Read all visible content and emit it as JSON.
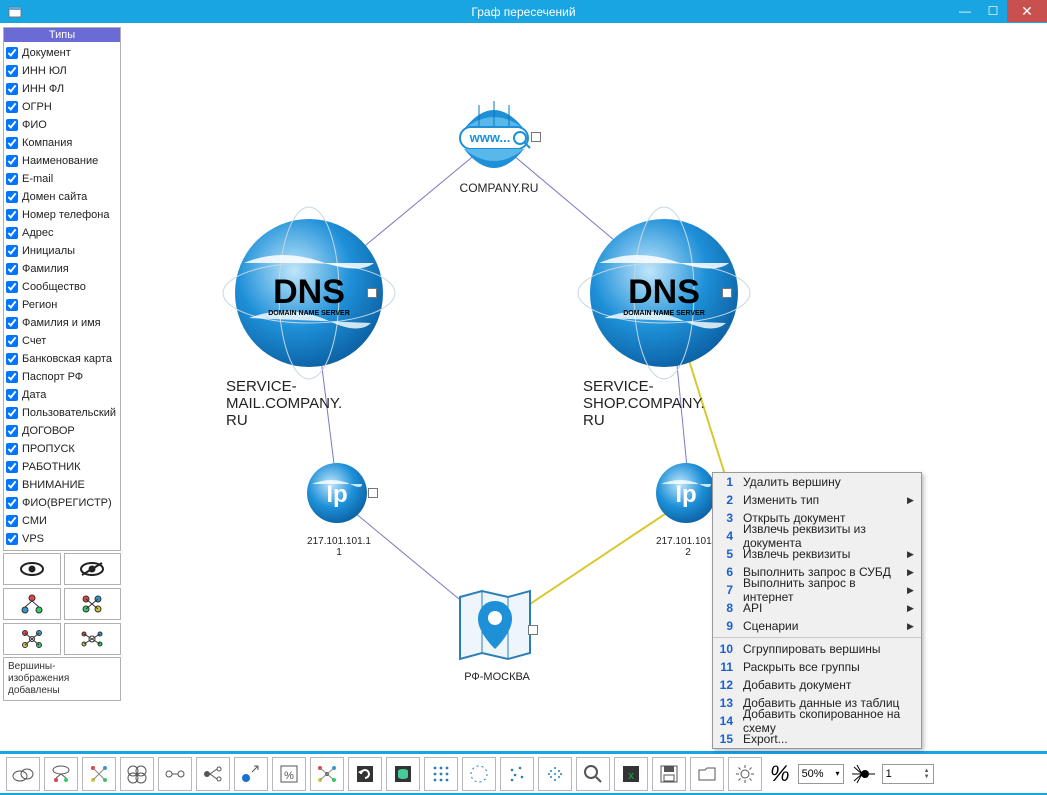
{
  "window": {
    "title": "Граф пересечений"
  },
  "sidebar": {
    "types_title": "Типы",
    "types": [
      "Документ",
      "ИНН ЮЛ",
      "ИНН ФЛ",
      "ОГРН",
      "ФИО",
      "Компания",
      "Наименование",
      "E-mail",
      "Домен сайта",
      "Номер телефона",
      "Адрес",
      "Инициалы",
      "Фамилия",
      "Сообщество",
      "Регион",
      "Фамилия и имя",
      "Счет",
      "Банковская карта",
      "Паспорт РФ",
      "Дата",
      "Пользовательский",
      "ДОГОВОР",
      "ПРОПУСК",
      "РАБОТНИК",
      "ВНИМАНИЕ",
      "ФИО(BРЕГИСТР)",
      "СМИ",
      "VPS"
    ],
    "status": "Вершины-\nизображения\nдобавлены"
  },
  "nodes": {
    "company": {
      "label": "COMPANY.RU",
      "www": "www...",
      "dns": "DNS",
      "dns_sub": "DOMAIN NAME SERVER",
      "ip": "Ip"
    },
    "dns1": {
      "label": "SERVICE-\nMAIL.COMPANY.\nRU"
    },
    "dns2": {
      "label": "SERVICE-\nSHOP.COMPANY.\nRU"
    },
    "ip1": {
      "label": "217.101.101.1",
      "sub": "1"
    },
    "ip2": {
      "label": "217.101.101.1",
      "sub": "2"
    },
    "map": {
      "label": "РФ-МОСКВА"
    }
  },
  "context_menu": {
    "items": [
      {
        "n": "1",
        "label": "Удалить вершину",
        "sub": false
      },
      {
        "n": "2",
        "label": "Изменить тип",
        "sub": true
      },
      {
        "n": "3",
        "label": "Открыть документ",
        "sub": false
      },
      {
        "n": "4",
        "label": "Извлечь реквизиты из документа",
        "sub": false
      },
      {
        "n": "5",
        "label": "Извлечь реквизиты",
        "sub": true
      },
      {
        "n": "6",
        "label": "Выполнить запрос в СУБД",
        "sub": true
      },
      {
        "n": "7",
        "label": "Выполнить запрос в интернет",
        "sub": true
      },
      {
        "n": "8",
        "label": "API",
        "sub": true
      },
      {
        "n": "9",
        "label": "Сценарии",
        "sub": true
      }
    ],
    "items2": [
      {
        "n": "10",
        "label": "Сгруппировать вершины",
        "sub": false
      },
      {
        "n": "11",
        "label": "Раскрыть все группы",
        "sub": false
      },
      {
        "n": "12",
        "label": "Добавить документ",
        "sub": false
      },
      {
        "n": "13",
        "label": "Добавить данные из таблиц",
        "sub": false
      },
      {
        "n": "14",
        "label": "Добавить скопированное на схему",
        "sub": false
      },
      {
        "n": "15",
        "label": "Export...",
        "sub": false
      }
    ]
  },
  "toolbar": {
    "zoom_value": "50%",
    "percent_label": "%",
    "spin_value": "1"
  },
  "icons": {
    "eye": "eye",
    "eye_off": "eye-off",
    "graph1": "graph-tree",
    "graph2": "graph-circle",
    "graph3": "graph-mesh",
    "graph4": "graph-force"
  }
}
